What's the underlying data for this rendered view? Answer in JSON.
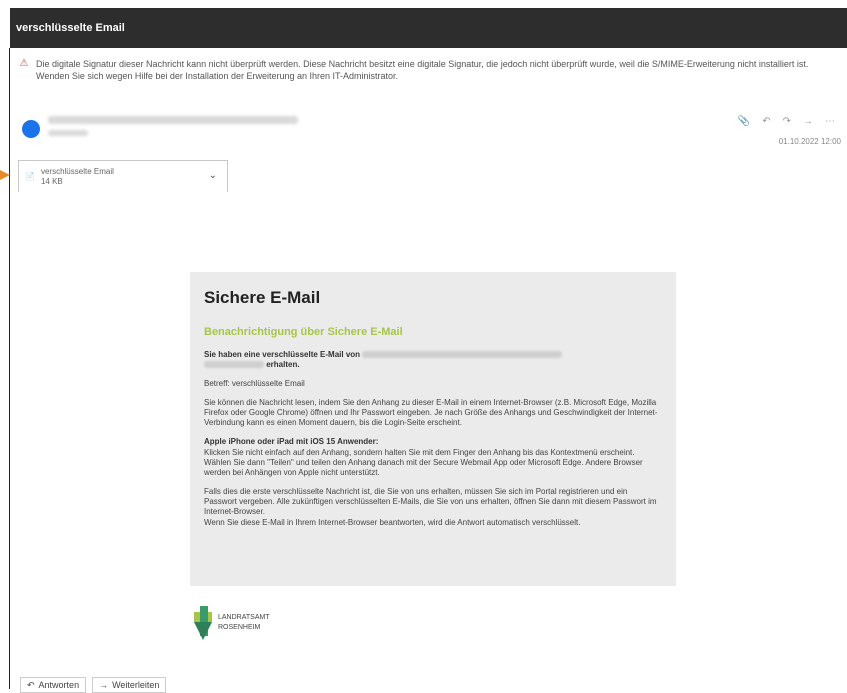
{
  "window": {
    "title": "verschlüsselte Email"
  },
  "warning": {
    "text": "Die digitale Signatur dieser Nachricht kann nicht überprüft werden. Diese Nachricht besitzt eine digitale Signatur, die jedoch nicht überprüft wurde, weil die S/MIME-Erweiterung nicht installiert ist. Wenden Sie sich wegen Hilfe bei der Installation der Erweiterung an Ihren IT-Administrator."
  },
  "message": {
    "date": "01.10.2022 12:00"
  },
  "attachment": {
    "name": "verschlüsselte Email",
    "size": "14 KB"
  },
  "mail": {
    "title": "Sichere E-Mail",
    "subtitle": "Benachrichtigung über Sichere E-Mail",
    "received_prefix": "Sie haben eine verschlüsselte E-Mail von",
    "received_suffix": "erhalten.",
    "subject": "Betreff: verschlüsselte Email",
    "instructions": "Sie können die Nachricht lesen, indem Sie den Anhang zu dieser E-Mail in einem Internet-Browser (z.B. Microsoft Edge, Mozilla Firefox oder Google Chrome) öffnen und Ihr Passwort eingeben. Je nach Größe des Anhangs und Geschwindigkeit der Internet-Verbindung kann es einen Moment dauern, bis die Login-Seite erscheint.",
    "apple_heading": "Apple iPhone oder iPad mit iOS 15 Anwender:",
    "apple_text": "Klicken Sie nicht einfach auf den Anhang, sondern halten Sie mit dem Finger den Anhang bis das Kontextmenü erscheint. Wählen Sie dann \"Teilen\" und teilen den Anhang danach mit der Secure Webmail App oder Microsoft Edge. Andere Browser werden bei Anhängen von Apple nicht unterstützt.",
    "first_time": "Falls dies die erste verschlüsselte Nachricht ist, die Sie von uns erhalten, müssen Sie sich im Portal registrieren und ein Passwort vergeben. Alle zukünftigen verschlüsselten E-Mails, die Sie von uns erhalten, öffnen Sie dann mit diesem Passwort im Internet-Browser.",
    "reply_note": "Wenn Sie diese E-Mail in Ihrem Internet-Browser beantworten, wird die Antwort automatisch verschlüsselt."
  },
  "logo": {
    "line1": "LANDRATSAMT",
    "line2": "ROSENHEIM"
  },
  "footer": {
    "reply": "Antworten",
    "forward": "Weiterleiten"
  },
  "colors": {
    "accent_green": "#a7c548",
    "avatar_blue": "#1a73e8",
    "arrow_orange": "#e68a2e"
  }
}
